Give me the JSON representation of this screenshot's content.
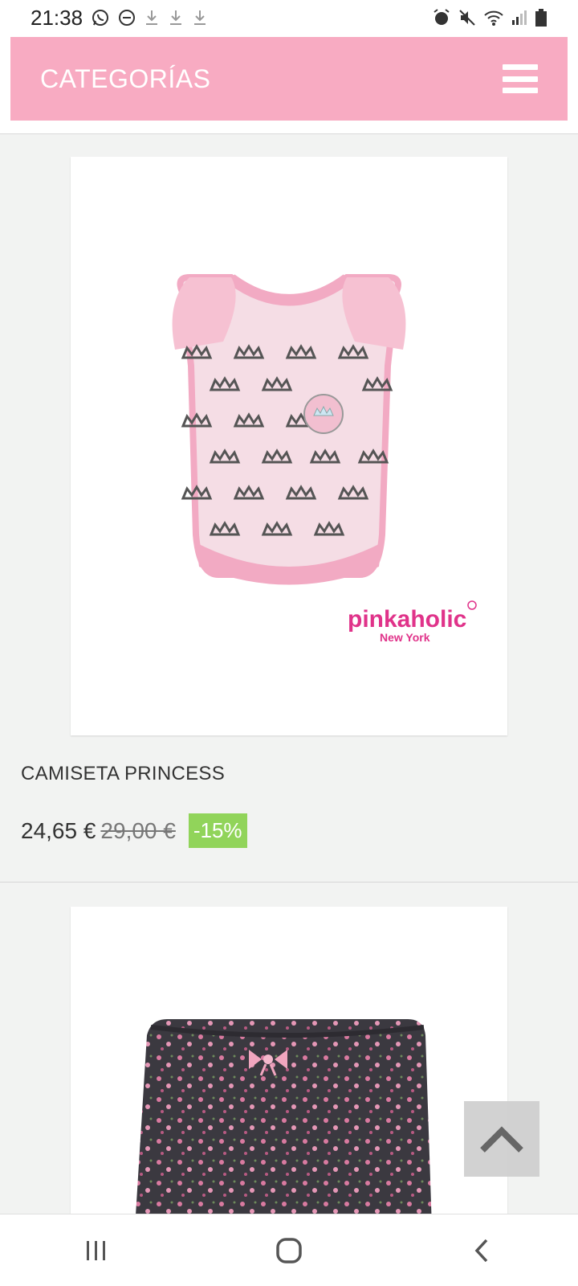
{
  "status_bar": {
    "time": "21:38",
    "icons_left": [
      "whatsapp-icon",
      "dnd-icon",
      "download-icon",
      "download-icon",
      "download-icon"
    ],
    "icons_right": [
      "alarm-icon",
      "mute-icon",
      "wifi-icon",
      "signal-icon",
      "battery-icon"
    ]
  },
  "header": {
    "title": "CATEGORÍAS",
    "menu_icon": "hamburger-menu-icon",
    "background": "#f8abc2"
  },
  "products": [
    {
      "name": "CAMISETA PRINCESS",
      "price": "24,65 €",
      "old_price": "29,00 €",
      "discount": "-15%",
      "image": {
        "brand": "pinkaholic",
        "brand_sub": "New York",
        "description": "pink dog t-shirt with crown pattern"
      }
    },
    {
      "name": "",
      "image": {
        "description": "dark floral dog shorts with pink bow"
      }
    }
  ],
  "scroll_top_icon": "chevron-up-icon",
  "nav_bar": {
    "recents_icon": "recents-icon",
    "home_icon": "home-icon",
    "back_icon": "back-icon"
  },
  "colors": {
    "accent_pink": "#f8abc2",
    "discount_green": "#91d45a",
    "brand_pink": "#e0338a"
  }
}
